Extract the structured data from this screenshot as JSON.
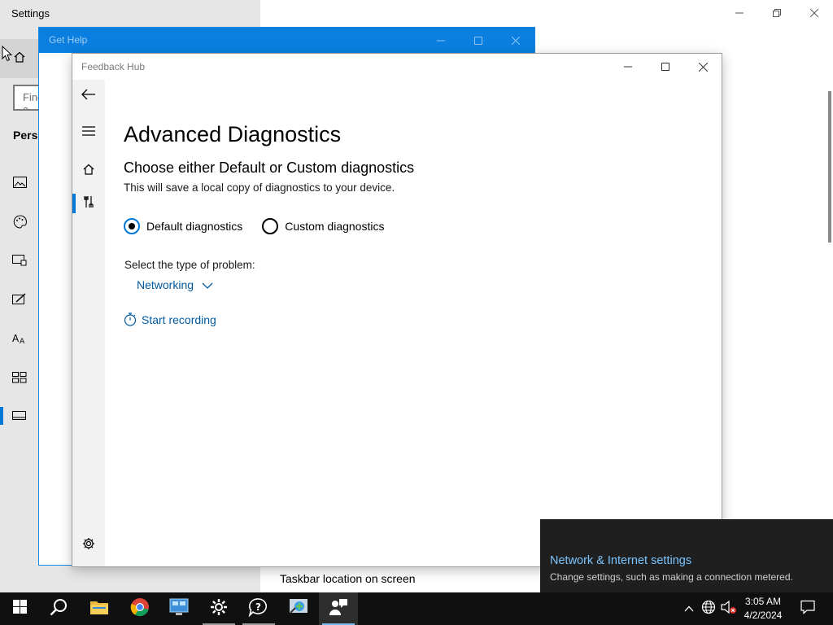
{
  "settings": {
    "title": "Settings",
    "search_placeholder": "Find a setting",
    "section_label": "Personalization",
    "nav_icons": [
      "background-icon",
      "colors-icon",
      "lock-screen-icon",
      "themes-icon",
      "fonts-icon",
      "start-icon",
      "taskbar-icon"
    ],
    "taskbar_location_label": "Taskbar location on screen"
  },
  "get_help": {
    "title": "Get Help"
  },
  "feedback_hub": {
    "title": "Feedback Hub",
    "heading": "Advanced Diagnostics",
    "subheading": "Choose either Default or Custom diagnostics",
    "description": "This will save a local copy of diagnostics to your device.",
    "radio_options": [
      {
        "label": "Default diagnostics",
        "checked": true
      },
      {
        "label": "Custom diagnostics",
        "checked": false
      }
    ],
    "problem_type_label": "Select the type of problem:",
    "problem_type_value": "Networking",
    "start_recording_label": "Start recording"
  },
  "toast": {
    "title": "Network & Internet settings",
    "text": "Change settings, such as making a connection metered."
  },
  "taskbar": {
    "apps": [
      "start-button",
      "search-button",
      "file-explorer",
      "chrome",
      "control-panel",
      "settings",
      "get-help",
      "network-diagnostics",
      "feedback-hub"
    ],
    "time": "3:05 AM",
    "date": "4/2/2024"
  },
  "colors": {
    "accent": "#0078d7",
    "link": "#005a9e",
    "get_help_titlebar": "#0a7fe0",
    "toast_bg": "#1f1f1f",
    "toast_title": "#7cc5ff",
    "taskbar_bg": "#101010"
  }
}
